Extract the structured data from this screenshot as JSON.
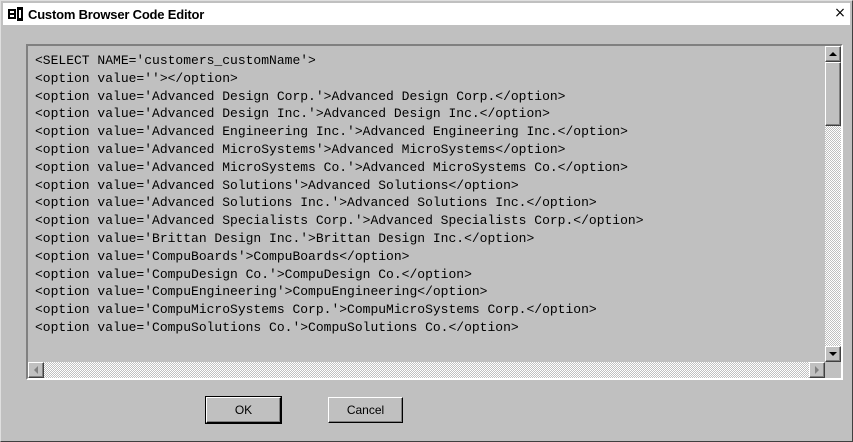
{
  "window": {
    "title": "Custom Browser Code Editor",
    "close_glyph": "×"
  },
  "icons": {
    "title_icon": "app-icon",
    "close": "close-icon",
    "scroll_up": "arrow-up-icon",
    "scroll_down": "arrow-down-icon",
    "scroll_left": "arrow-left-icon",
    "scroll_right": "arrow-right-icon"
  },
  "editor": {
    "lines": [
      "<SELECT NAME='customers_customName'>",
      "<option value=''></option>",
      "<option value='Advanced Design Corp.'>Advanced Design Corp.</option>",
      "<option value='Advanced Design Inc.'>Advanced Design Inc.</option>",
      "<option value='Advanced Engineering Inc.'>Advanced Engineering Inc.</option>",
      "<option value='Advanced MicroSystems'>Advanced MicroSystems</option>",
      "<option value='Advanced MicroSystems Co.'>Advanced MicroSystems Co.</option>",
      "<option value='Advanced Solutions'>Advanced Solutions</option>",
      "<option value='Advanced Solutions Inc.'>Advanced Solutions Inc.</option>",
      "<option value='Advanced Specialists Corp.'>Advanced Specialists Corp.</option>",
      "<option value='Brittan Design Inc.'>Brittan Design Inc.</option>",
      "<option value='CompuBoards'>CompuBoards</option>",
      "<option value='CompuDesign Co.'>CompuDesign Co.</option>",
      "<option value='CompuEngineering'>CompuEngineering</option>",
      "<option value='CompuMicroSystems Corp.'>CompuMicroSystems Corp.</option>",
      "<option value='CompuSolutions Co.'>CompuSolutions Co.</option>"
    ]
  },
  "buttons": {
    "ok": "OK",
    "cancel": "Cancel"
  },
  "colors": {
    "face": "#c0c0c0",
    "title_bg": "#ffffff",
    "text": "#000000"
  }
}
